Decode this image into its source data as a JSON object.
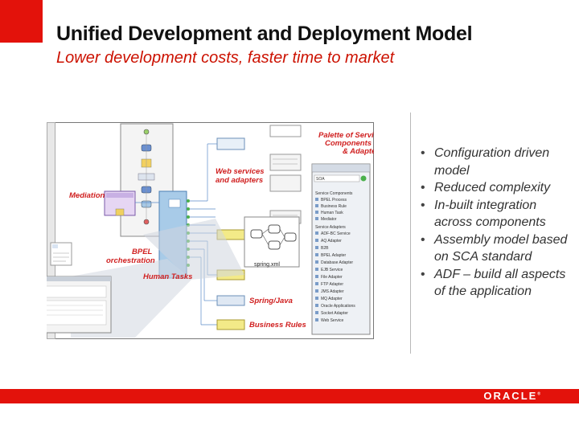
{
  "slide": {
    "title": "Unified Development and Deployment Model",
    "subtitle": "Lower development costs, faster time to market",
    "brand_color": "#e3120b",
    "subtitle_color": "#cc1100"
  },
  "diagram": {
    "callouts": {
      "palette": [
        "Palette of Service",
        "Components",
        "& Adapters"
      ],
      "web_services": [
        "Web services",
        "and adapters"
      ],
      "mediation": "Mediation",
      "bpel": [
        "BPEL",
        "orchestration"
      ],
      "human_tasks": "Human Tasks",
      "spring_java": "Spring/Java",
      "business_rules": "Business Rules"
    },
    "spring_file": "spring.xml",
    "palette_panel": {
      "dropdown": "SOA",
      "section_service_components": "Service Components",
      "service_components": [
        "BPEL Process",
        "Business Rule",
        "Human Task",
        "Mediator"
      ],
      "section_service_adapters": "Service Adapters",
      "service_adapters": [
        "ADF-BC Service",
        "AQ Adapter",
        "B2B",
        "BPEL Adapter",
        "Database Adapter",
        "EJB Service",
        "File Adapter",
        "FTP Adapter",
        "JMS Adapter",
        "MQ Adapter",
        "Oracle Applications",
        "Socket Adapter",
        "Web Service"
      ]
    }
  },
  "bullets": [
    "Configuration driven model",
    "Reduced complexity",
    "In-built integration across components",
    "Assembly model based on SCA standard",
    "ADF – build all aspects of the application"
  ],
  "footer": {
    "logo": "ORACLE",
    "logo_mark": "®"
  }
}
